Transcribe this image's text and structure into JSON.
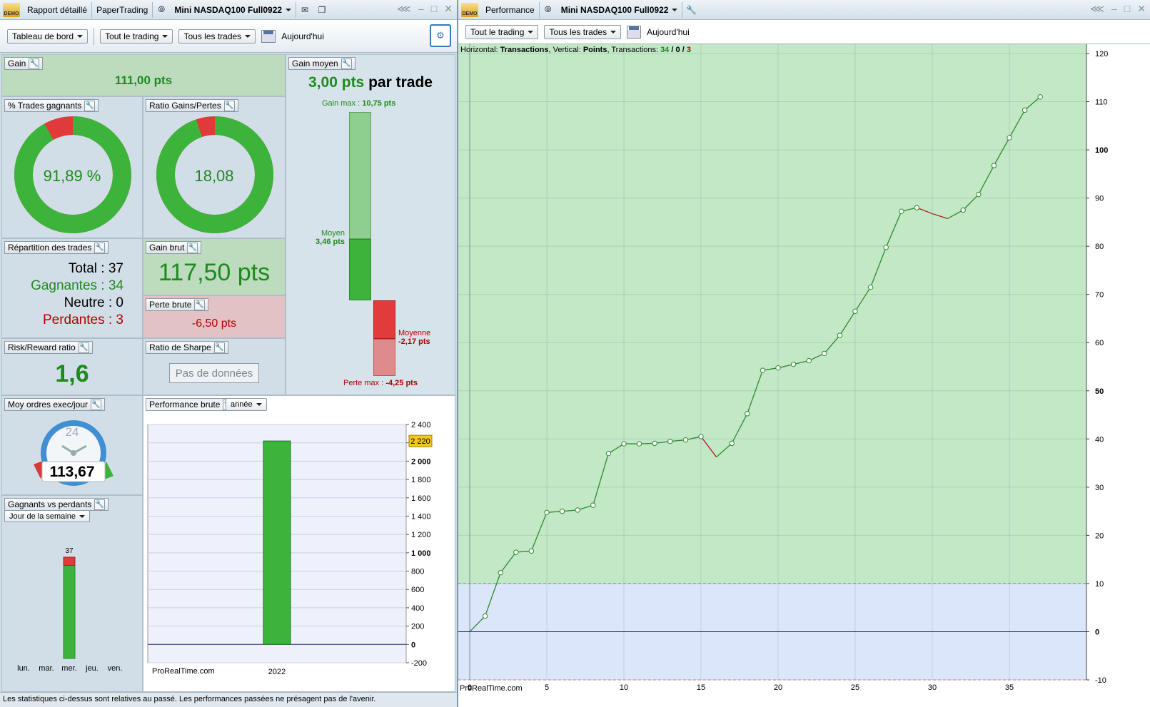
{
  "left_window": {
    "tabs": [
      "Rapport détaillé",
      "PaperTrading",
      "Mini NASDAQ100 Full0922"
    ],
    "toolbar": {
      "dashboard": "Tableau de bord",
      "all_trading": "Tout le trading",
      "all_trades": "Tous les trades",
      "today": "Aujourd'hui"
    },
    "demo_badge": "DEMO"
  },
  "panels": {
    "gain": {
      "label": "Gain",
      "value": "111,00 pts"
    },
    "win_pct": {
      "label": "% Trades gagnants",
      "value": "91,89 %",
      "fraction": 0.9189
    },
    "win_loss_ratio": {
      "label": "Ratio Gains/Pertes",
      "value": "18,08",
      "fraction": 0.9476
    },
    "avg_gain": {
      "label": "Gain moyen",
      "value": "3,00 pts",
      "suffix": "par trade",
      "max_label": "Gain max :",
      "max_value": "10,75 pts",
      "mean_label": "Moyen",
      "mean_value": "3,46 pts",
      "loss_mean_label": "Moyenne",
      "loss_mean_value": "-2,17 pts",
      "loss_max_label": "Perte max :",
      "loss_max_value": "-4,25 pts",
      "gain_max_num": 10.75,
      "gain_mean_num": 3.46,
      "loss_mean_num": -2.17,
      "loss_max_num": -4.25
    },
    "breakdown": {
      "label": "Répartition des trades",
      "total": "Total : 37",
      "winners": "Gagnantes : 34",
      "neutral": "Neutre : 0",
      "losers": "Perdantes : 3"
    },
    "gross_gain": {
      "label": "Gain brut",
      "value": "117,50 pts"
    },
    "gross_loss": {
      "label": "Perte brute",
      "value": "-6,50 pts"
    },
    "risk_reward": {
      "label": "Risk/Reward ratio",
      "value": "1,6"
    },
    "sharpe": {
      "label": "Ratio de Sharpe",
      "button": "Pas de données"
    },
    "avg_orders": {
      "label": "Moy ordres exec/jour",
      "value": "113,67",
      "dial": "24"
    },
    "gross_perf": {
      "label": "Performance brute",
      "period": "année",
      "watermark": "ProRealTime.com"
    },
    "winners_vs_losers": {
      "label": "Gagnants vs perdants",
      "period": "Jour de la semaine",
      "days": [
        "lun.",
        "mar.",
        "mer.",
        "jeu.",
        "ven."
      ],
      "count_label": "37"
    }
  },
  "status": "Les statistiques ci-dessus sont relatives au passé. Les performances passées ne présagent pas de l'avenir.",
  "right_window": {
    "tabs": [
      "Performance",
      "Mini NASDAQ100 Full0922"
    ],
    "toolbar": {
      "all_trading": "Tout le trading",
      "all_trades": "Tous les trades",
      "today": "Aujourd'hui"
    },
    "info": {
      "h_label": "Horizontal:",
      "h_value": "Transactions",
      "v_label": "Vertical:",
      "v_value": "Points",
      "t_label": "Transactions:",
      "win": "34",
      "sep1": "/",
      "neutral": "0",
      "sep2": "/",
      "loss": "3"
    },
    "watermark": "ProRealTime.com"
  },
  "chart_data": [
    {
      "type": "bar",
      "categories": [
        "2022"
      ],
      "values": [
        2220
      ],
      "last_value_badge": "2 220",
      "ylim": [
        -200,
        2400
      ],
      "yticks": [
        "2 400",
        "2 200",
        "2 000",
        "1 800",
        "1 600",
        "1 400",
        "1 200",
        "1 000",
        "800",
        "600",
        "400",
        "200",
        "0",
        "-200"
      ]
    },
    {
      "type": "bar",
      "categories": [
        "mer."
      ],
      "series": [
        {
          "name": "gagnants",
          "values": [
            34
          ]
        },
        {
          "name": "perdants",
          "values": [
            3
          ]
        }
      ],
      "total_label": "37"
    },
    {
      "type": "line",
      "x": [
        0,
        1,
        2,
        3,
        4,
        5,
        6,
        7,
        8,
        9,
        10,
        11,
        12,
        13,
        14,
        15,
        16,
        17,
        18,
        19,
        20,
        21,
        22,
        23,
        24,
        25,
        26,
        27,
        28,
        29,
        30,
        31,
        32,
        33,
        34,
        35,
        36,
        37
      ],
      "y": [
        0,
        3.25,
        12.25,
        16.5,
        16.75,
        24.75,
        25,
        25.25,
        26.25,
        37,
        39,
        39,
        39.1,
        39.5,
        39.8,
        40.5,
        36.25,
        39.1,
        45.25,
        54.25,
        54.75,
        55.5,
        56.25,
        57.75,
        61.5,
        66.5,
        71.5,
        79.75,
        87.25,
        88,
        86.75,
        85.75,
        87.5,
        90.75,
        96.75,
        102.5,
        108.25,
        111
      ],
      "losing_segments_end_x": [
        16,
        30,
        31
      ],
      "xlim": [
        0,
        40
      ],
      "ylim": [
        -10,
        120
      ],
      "xticks": [
        "0",
        "5",
        "10",
        "15",
        "20",
        "25",
        "30",
        "35"
      ],
      "yticks": [
        "120",
        "110",
        "100",
        "90",
        "80",
        "70",
        "60",
        "50",
        "40",
        "30",
        "20",
        "10",
        "0",
        "-10"
      ],
      "xlabel": "Transactions",
      "ylabel": "Points"
    }
  ]
}
